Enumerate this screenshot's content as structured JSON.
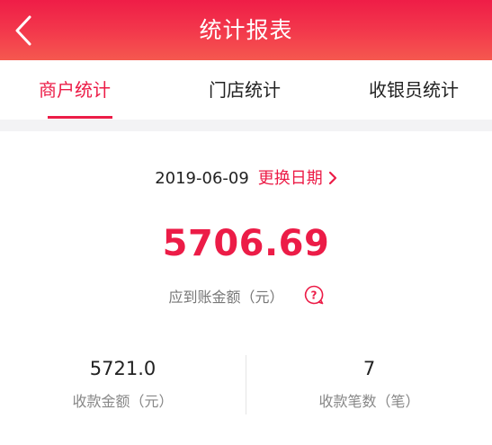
{
  "header": {
    "title": "统计报表",
    "back_icon": "chevron-left-icon"
  },
  "tabs": [
    {
      "label": "商户统计",
      "active": true
    },
    {
      "label": "门店统计",
      "active": false
    },
    {
      "label": "收银员统计",
      "active": false
    }
  ],
  "date": {
    "value": "2019-06-09",
    "change_label": "更换日期",
    "change_icon": "chevron-right-icon"
  },
  "summary": {
    "amount": "5706.69",
    "amount_label": "应到账金额（元）",
    "help_icon": "question-bubble-icon"
  },
  "stats": [
    {
      "value": "5721.0",
      "label": "收款金额（元）"
    },
    {
      "value": "7",
      "label": "收款笔数（笔）"
    }
  ],
  "colors": {
    "accent": "#ec1c47",
    "header_gradient_top": "#ef1d47",
    "header_gradient_bottom": "#f5584f"
  }
}
